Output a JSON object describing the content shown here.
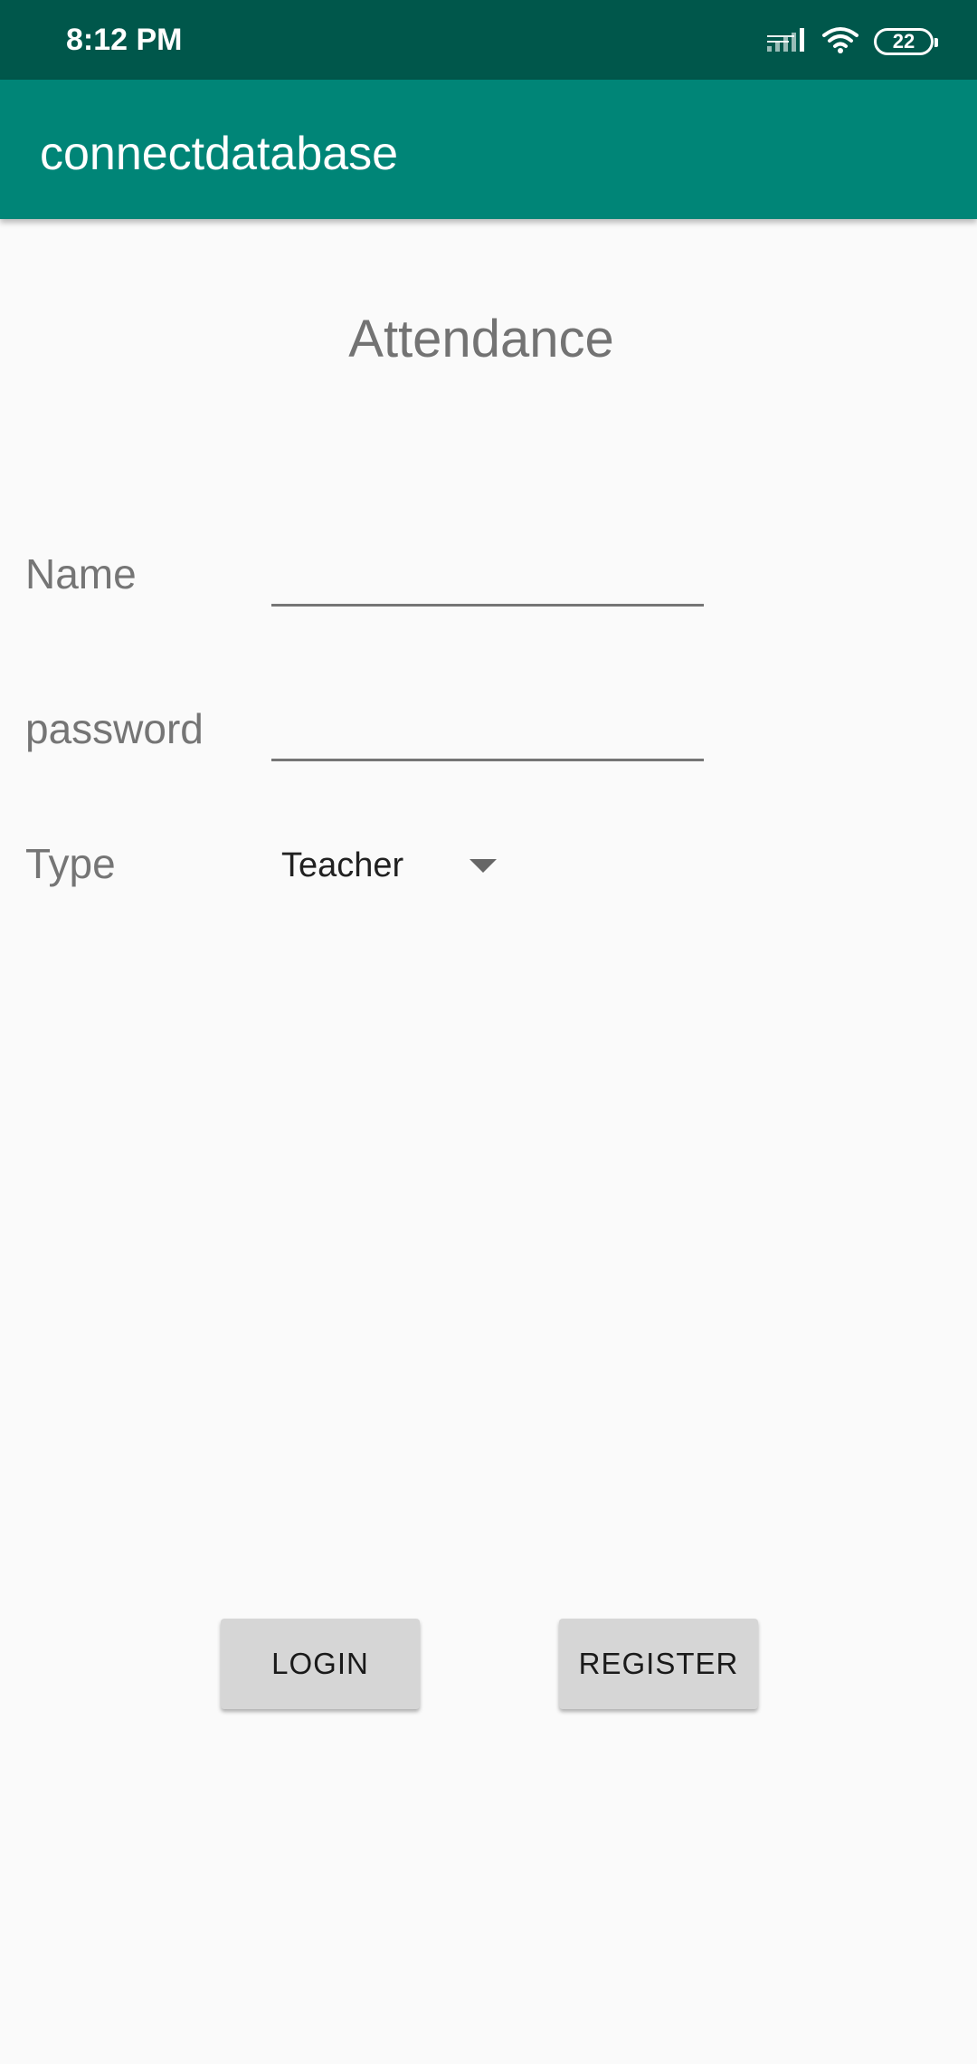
{
  "status_bar": {
    "time": "8:12 PM",
    "battery": "22",
    "icons": [
      "signal-icon",
      "wifi-icon",
      "battery-icon"
    ]
  },
  "app_bar": {
    "title": "connectdatabase"
  },
  "form": {
    "heading": "Attendance",
    "name_label": "Name",
    "name_value": "",
    "password_label": "password",
    "password_value": "",
    "type_label": "Type",
    "type_selected": "Teacher"
  },
  "actions": {
    "login_label": "LOGIN",
    "register_label": "REGISTER"
  },
  "colors": {
    "status_bar": "#00574b",
    "app_bar": "#008577",
    "background": "#fafafa",
    "button": "#d6d6d6"
  }
}
